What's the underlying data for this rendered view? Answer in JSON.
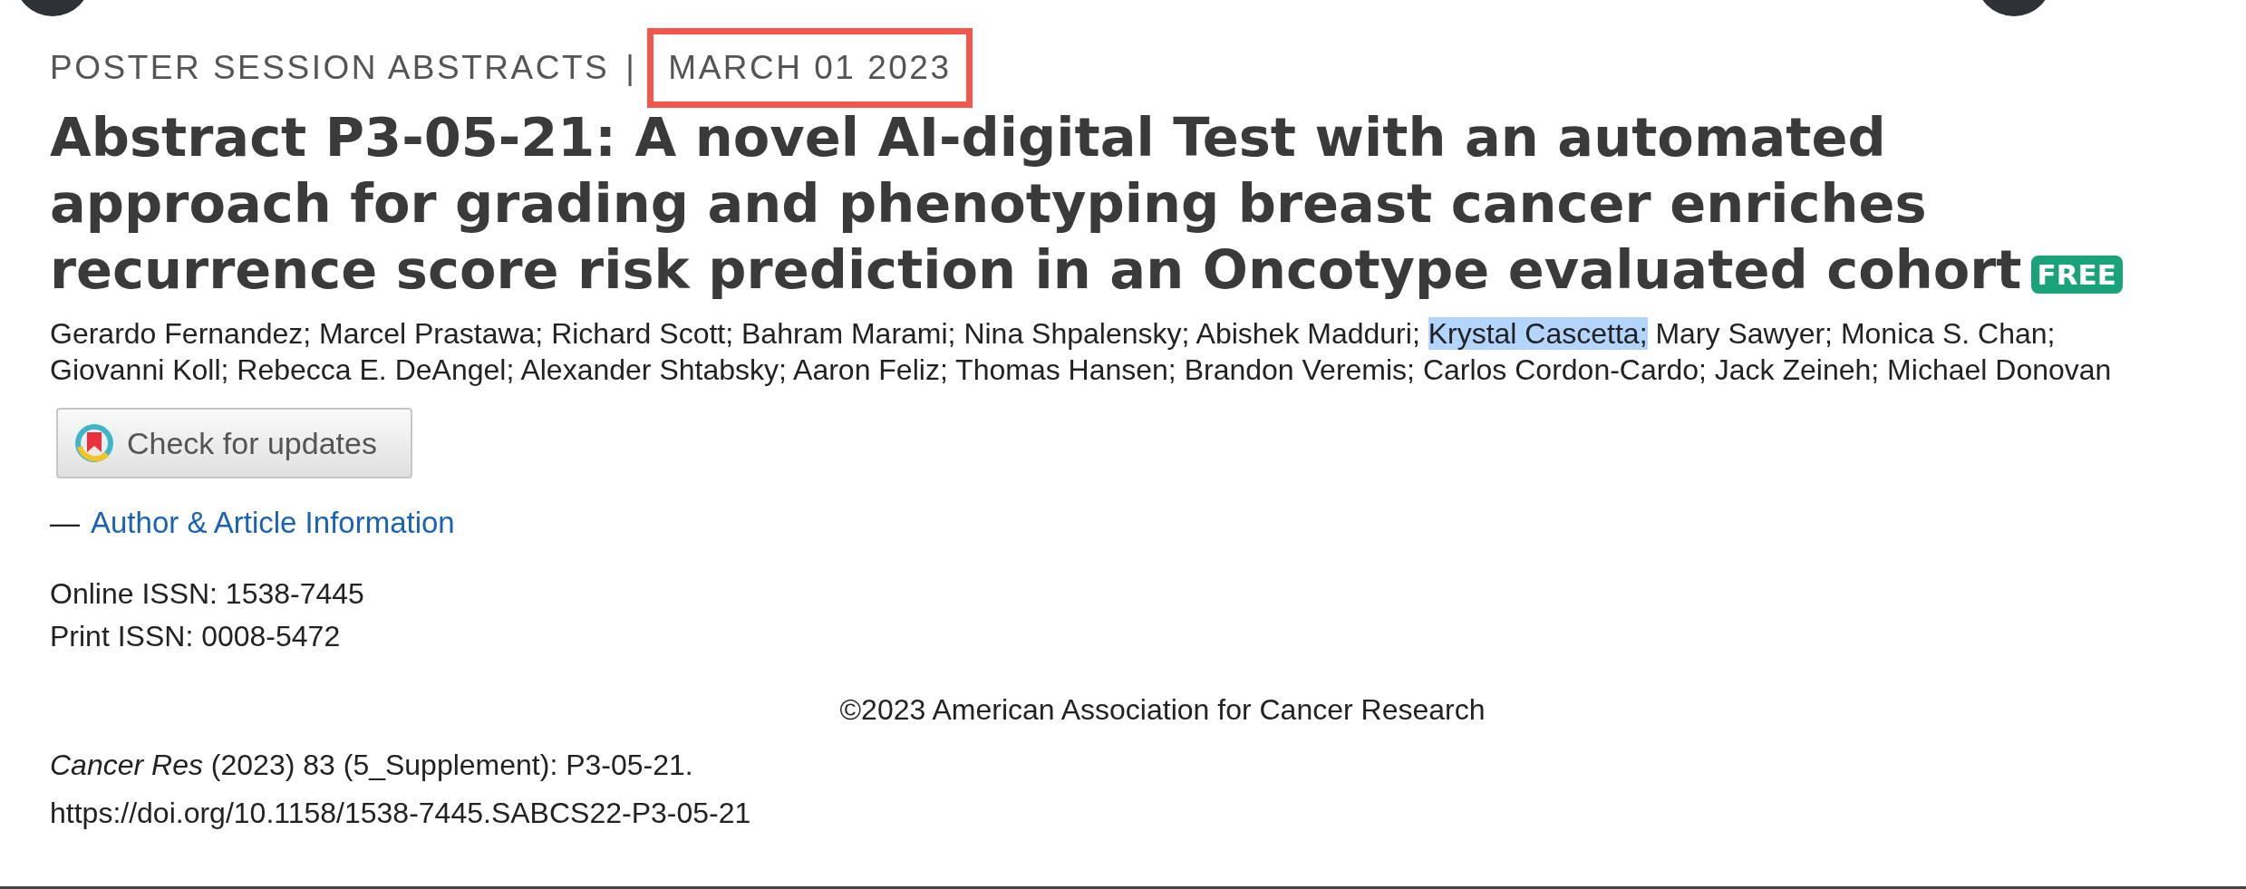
{
  "header": {
    "category": "POSTER SESSION ABSTRACTS",
    "separator": "|",
    "date": "MARCH 01 2023",
    "date_highlighted": true
  },
  "title": "Abstract P3-05-21: A novel AI-digital Test with an automated approach for grading and phenotyping breast cancer enriches recurrence score risk prediction in an Oncotype evaluated cohort",
  "badge": "FREE",
  "authors": [
    {
      "name": "Gerardo Fernandez;",
      "selected": false
    },
    {
      "name": "Marcel Prastawa;",
      "selected": false
    },
    {
      "name": "Richard Scott;",
      "selected": false
    },
    {
      "name": "Bahram Marami;",
      "selected": false
    },
    {
      "name": "Nina Shpalensky;",
      "selected": false
    },
    {
      "name": "Abishek Madduri;",
      "selected": false
    },
    {
      "name": "Krystal Cascetta;",
      "selected": true
    },
    {
      "name": "Mary Sawyer;",
      "selected": false
    },
    {
      "name": "Monica S. Chan;",
      "selected": false
    },
    {
      "name": "Giovanni Koll;",
      "selected": false
    },
    {
      "name": "Rebecca E. DeAngel;",
      "selected": false
    },
    {
      "name": "Alexander Shtabsky;",
      "selected": false
    },
    {
      "name": "Aaron Feliz;",
      "selected": false
    },
    {
      "name": "Thomas Hansen;",
      "selected": false
    },
    {
      "name": "Brandon Veremis;",
      "selected": false
    },
    {
      "name": "Carlos Cordon-Cardo;",
      "selected": false
    },
    {
      "name": "Jack Zeineh;",
      "selected": false
    },
    {
      "name": "Michael Donovan",
      "selected": false
    }
  ],
  "update_button": {
    "label": "Check for updates"
  },
  "info_toggle": {
    "symbol": "—",
    "label": "Author & Article Information"
  },
  "issn": [
    "Online ISSN: 1538-7445",
    "Print ISSN: 0008-5472"
  ],
  "copyright": "©2023 American Association for Cancer Research",
  "citation": "*Cancer Res* (2023) 83 (5_Supplement): P3-05-21.",
  "doi": "https://doi.org/10.1158/1538-7445.SABCS22-P3-05-21"
}
